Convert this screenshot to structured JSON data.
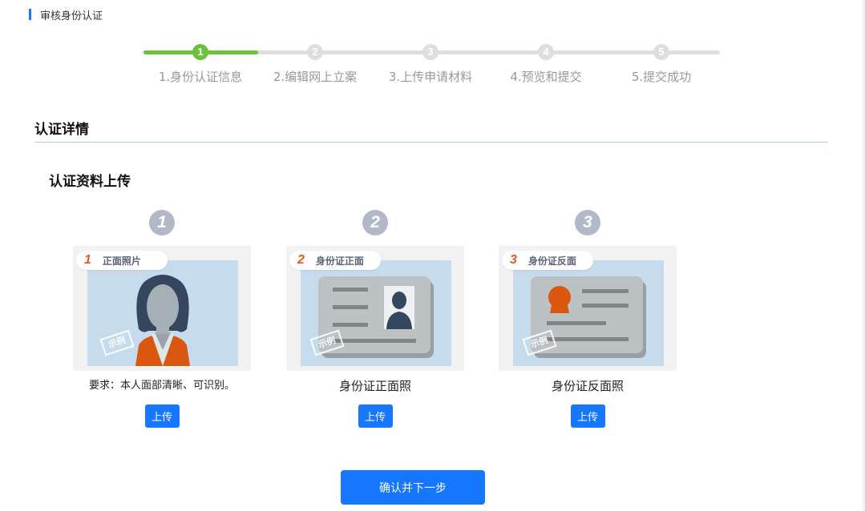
{
  "header": {
    "title": "审核身份认证"
  },
  "stepper": {
    "current_step": 1,
    "steps": [
      {
        "index": "1",
        "label": "1.身份认证信息"
      },
      {
        "index": "2",
        "label": "2.编辑网上立案"
      },
      {
        "index": "3",
        "label": "3.上传申请材料"
      },
      {
        "index": "4",
        "label": "4.预览和提交"
      },
      {
        "index": "5",
        "label": "5.提交成功"
      }
    ],
    "colors": {
      "active": "#6cc33a",
      "inactive": "#dedede"
    }
  },
  "section": {
    "title": "认证详情",
    "subtitle": "认证资料上传"
  },
  "cards": [
    {
      "number": "1",
      "tag_number": "1",
      "tag_text": "正面照片",
      "stamp": "示例",
      "caption": "要求：本人面部清晰、可识别。",
      "button": "上传",
      "icon": "person-portrait-icon"
    },
    {
      "number": "2",
      "tag_number": "2",
      "tag_text": "身份证正面",
      "stamp": "示例",
      "caption": "身份证正面照",
      "button": "上传",
      "icon": "id-card-front-icon"
    },
    {
      "number": "3",
      "tag_number": "3",
      "tag_text": "身份证反面",
      "stamp": "示例",
      "caption": "身份证反面照",
      "button": "上传",
      "icon": "id-card-back-icon"
    }
  ],
  "footer": {
    "confirm_label": "确认并下一步"
  },
  "colors": {
    "primary": "#1677ff",
    "accent_orange": "#e55a1b",
    "divider": "#a8d4e6"
  }
}
